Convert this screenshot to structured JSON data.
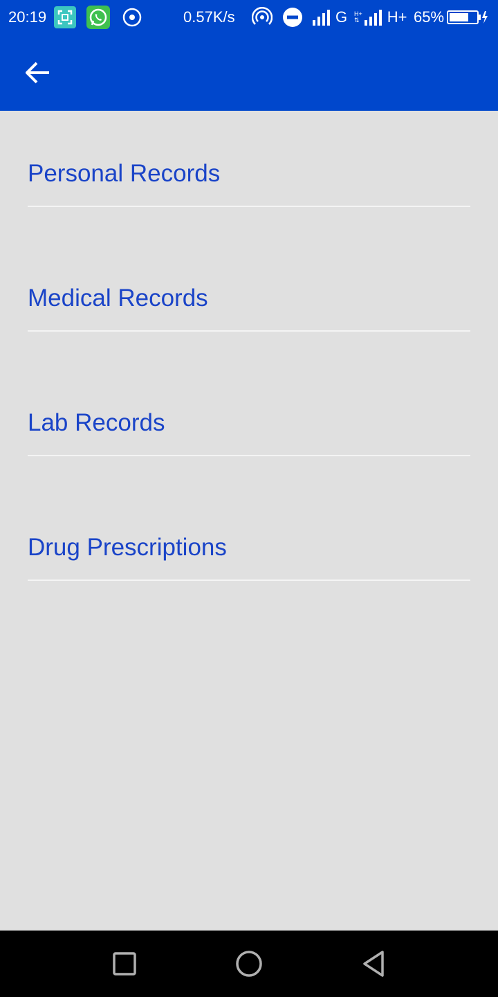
{
  "status_bar": {
    "time": "20:19",
    "net_speed": "0.57K/s",
    "signal1_label": "G",
    "signal2_label": "H+",
    "signal2_small": "H+",
    "battery_percent": "65%",
    "icons": [
      "screenshot-icon",
      "whatsapp-icon",
      "circle-dot-icon",
      "hotspot-icon",
      "do-not-disturb-icon",
      "signal-icon",
      "signal-icon",
      "battery-icon",
      "charging-icon"
    ]
  },
  "app_bar": {
    "back_icon": "arrow-left-icon",
    "color": "#0047cc"
  },
  "menu": {
    "items": [
      {
        "label": "Personal Records"
      },
      {
        "label": "Medical Records"
      },
      {
        "label": "Lab Records"
      },
      {
        "label": "Drug Prescriptions"
      }
    ],
    "text_color": "#1a44c8"
  },
  "nav_bar": {
    "icons": [
      "square-recents-icon",
      "circle-home-icon",
      "triangle-back-icon"
    ]
  }
}
